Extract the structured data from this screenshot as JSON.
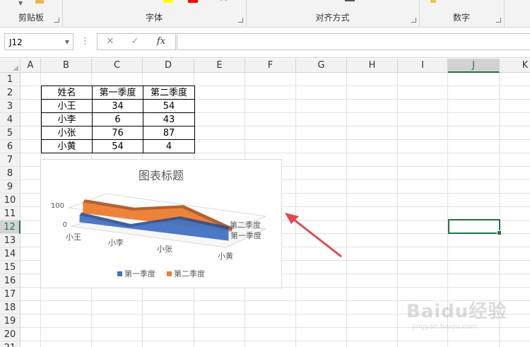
{
  "ribbon": {
    "groups": [
      {
        "label": "剪贴板"
      },
      {
        "label": "字体"
      },
      {
        "label": "对齐方式"
      },
      {
        "label": "数字"
      }
    ]
  },
  "formula_bar": {
    "name_box": "J12",
    "cancel_icon": "✕",
    "enter_icon": "✓",
    "fx_label": "fx",
    "value": ""
  },
  "columns": [
    "A",
    "B",
    "C",
    "D",
    "E",
    "F",
    "G",
    "H",
    "I",
    "J",
    "K"
  ],
  "rows": [
    "1",
    "2",
    "3",
    "4",
    "5",
    "6",
    "7",
    "8",
    "9",
    "10",
    "11",
    "12",
    "13",
    "14",
    "15",
    "16",
    "17",
    "18",
    "19",
    "20",
    "21"
  ],
  "selected_cell": "J12",
  "table": {
    "headers": [
      "姓名",
      "第一季度",
      "第二季度"
    ],
    "rows": [
      [
        "小王",
        "34",
        "54"
      ],
      [
        "小李",
        "6",
        "43"
      ],
      [
        "小张",
        "76",
        "87"
      ],
      [
        "小黄",
        "54",
        "4"
      ]
    ]
  },
  "chart_data": {
    "type": "area",
    "title": "图表标题",
    "categories": [
      "小王",
      "小李",
      "小张",
      "小黄"
    ],
    "series": [
      {
        "name": "第一季度",
        "values": [
          34,
          6,
          76,
          54
        ],
        "color": "#4472c4"
      },
      {
        "name": "第二季度",
        "values": [
          54,
          43,
          87,
          4
        ],
        "color": "#ed7d31"
      }
    ],
    "y_ticks": [
      "0",
      "100"
    ],
    "ylim": [
      0,
      100
    ],
    "legend_position": "bottom",
    "style": "3d"
  },
  "watermark": {
    "text": "Baidu经验",
    "sub": "jingyan.baidu.com"
  }
}
